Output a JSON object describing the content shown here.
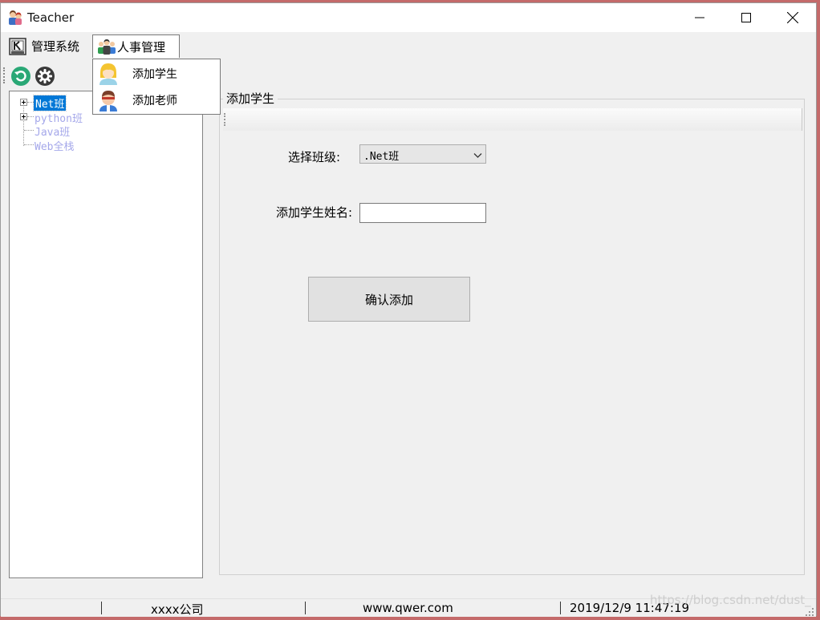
{
  "window": {
    "title": "Teacher"
  },
  "menu": {
    "items": [
      {
        "label": "管理系统",
        "icon": "system-k-icon"
      },
      {
        "label": "人事管理",
        "icon": "people-group-icon"
      }
    ],
    "dropdown": [
      {
        "label": "添加学生",
        "icon": "student-avatar-icon"
      },
      {
        "label": "添加老师",
        "icon": "teacher-avatar-icon"
      }
    ]
  },
  "toolbar": {
    "icons": [
      "refresh-icon",
      "gear-icon"
    ]
  },
  "tree": {
    "nodes": [
      {
        "label": "Net班",
        "selected": true,
        "expandable": true
      },
      {
        "label": "python班",
        "expandable": true
      },
      {
        "label": "Java班"
      },
      {
        "label": "Web全栈"
      }
    ]
  },
  "form": {
    "group_title": "添加学生",
    "class_label": "选择班级:",
    "class_value": ".Net班",
    "name_label": "添加学生姓名:",
    "name_value": "",
    "submit_label": "确认添加"
  },
  "status": {
    "company": "xxxx公司",
    "website": "www.qwer.com",
    "datetime": "2019/12/9 11:47:19"
  },
  "watermark": "https://blog.csdn.net/dust_",
  "colors": {
    "selection": "#0078d7",
    "dim_node": "#a5a8ea"
  }
}
